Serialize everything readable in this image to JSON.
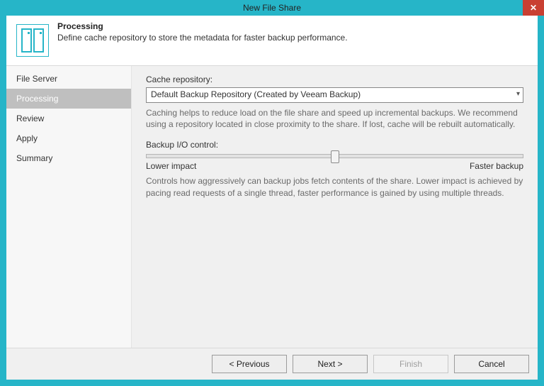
{
  "window": {
    "title": "New File Share"
  },
  "header": {
    "title": "Processing",
    "subtitle": "Define cache repository to store the metadata for faster backup performance."
  },
  "sidebar": {
    "items": [
      {
        "label": "File Server"
      },
      {
        "label": "Processing"
      },
      {
        "label": "Review"
      },
      {
        "label": "Apply"
      },
      {
        "label": "Summary"
      }
    ],
    "active_index": 1
  },
  "content": {
    "cache_label": "Cache repository:",
    "cache_value": "Default Backup Repository (Created by Veeam Backup)",
    "cache_help": "Caching helps to reduce load on the file share and speed up incremental backups. We recommend using a repository located in close proximity to the share. If lost, cache will be rebuilt automatically.",
    "io_label": "Backup I/O control:",
    "io_low": "Lower impact",
    "io_high": "Faster backup",
    "io_help": "Controls how aggressively can backup jobs fetch contents of the share. Lower impact is achieved by pacing read requests of a single thread, faster performance is gained by using multiple threads."
  },
  "footer": {
    "previous": "< Previous",
    "next": "Next >",
    "finish": "Finish",
    "cancel": "Cancel"
  }
}
